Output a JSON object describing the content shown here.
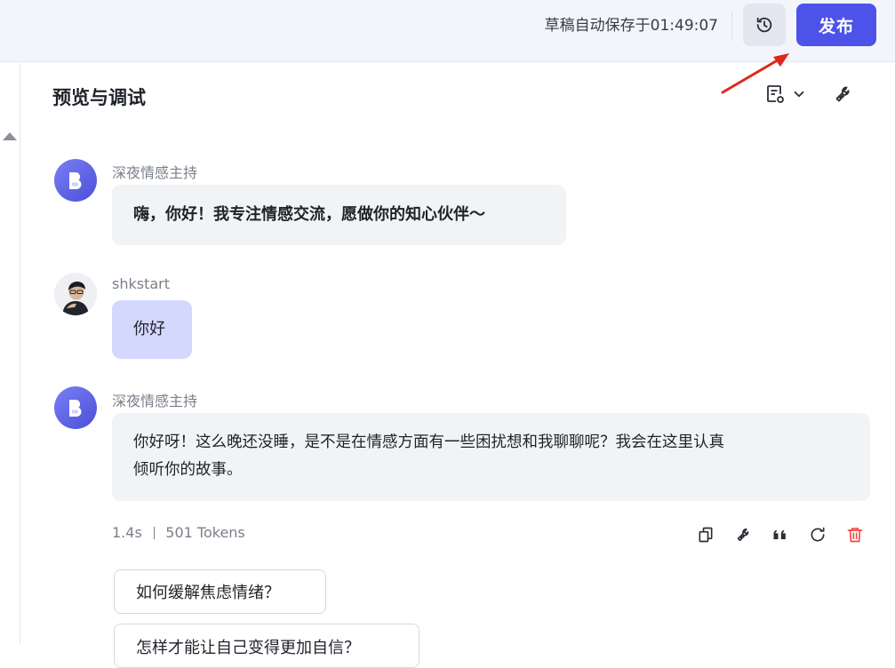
{
  "topbar": {
    "autosave_text": "草稿自动保存于01:49:07",
    "history_icon": "history-clock-icon",
    "publish_label": "发布",
    "accent_color": "#4d53e8",
    "annotation_color": "#e0261b"
  },
  "panel": {
    "title": "预览与调试",
    "tools": [
      {
        "icon": "memory-settings-icon",
        "has_dropdown": true
      },
      {
        "icon": "wrench-icon"
      }
    ]
  },
  "messages": [
    {
      "role": "bot",
      "sender": "深夜情感主持",
      "text": "嗨，你好！我专注情感交流，愿做你的知心伙伴～",
      "avatar_icon": "bot-avatar-icon"
    },
    {
      "role": "user",
      "sender": "shkstart",
      "text": "你好",
      "avatar_icon": "user-avatar-icon"
    },
    {
      "role": "bot",
      "sender": "深夜情感主持",
      "text_line1": "你好呀！这么晚还没睡，是不是在情感方面有一些困扰想和我聊聊呢？我会在这里认真",
      "text_line2": "倾听你的故事。",
      "avatar_icon": "bot-avatar-icon"
    }
  ],
  "response_meta": {
    "latency": "1.4s",
    "tokens": "501 Tokens",
    "actions": [
      "copy-icon",
      "debug-wrench-icon",
      "quote-icon",
      "regenerate-icon",
      "delete-icon"
    ],
    "delete_color": "#f54a45"
  },
  "suggestions": [
    "如何缓解焦虑情绪？",
    "怎样才能让自己变得更加自信？"
  ]
}
